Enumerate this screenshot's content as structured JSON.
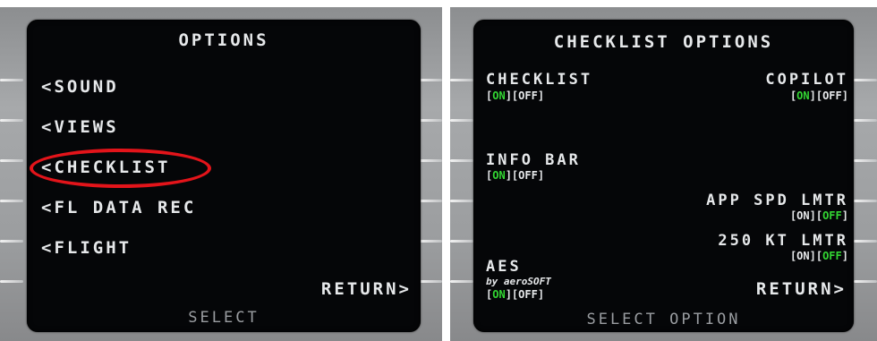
{
  "left_panel": {
    "title": "OPTIONS",
    "items": [
      {
        "label": "<SOUND"
      },
      {
        "label": "<VIEWS"
      },
      {
        "label": "<CHECKLIST"
      },
      {
        "label": "<FL DATA REC"
      },
      {
        "label": "<FLIGHT"
      }
    ],
    "return_label": "RETURN>",
    "footer": "SELECT",
    "highlight_color": "#e3141a"
  },
  "right_panel": {
    "title": "CHECKLIST OPTIONS",
    "checklist": {
      "label": "CHECKLIST",
      "on": "ON",
      "off": "OFF",
      "active": "on"
    },
    "copilot": {
      "label": "COPILOT",
      "on": "ON",
      "off": "OFF",
      "active": "on"
    },
    "info_bar": {
      "label": "INFO BAR",
      "on": "ON",
      "off": "OFF",
      "active": "on"
    },
    "app_spd_lmtr": {
      "label": "APP SPD LMTR",
      "on": "ON",
      "off": "OFF",
      "active": "off"
    },
    "kt_lmtr": {
      "label": "250 KT LMTR",
      "on": "ON",
      "off": "OFF",
      "active": "off"
    },
    "aes": {
      "label": "AES",
      "sublabel": "by aeroSOFT",
      "on": "ON",
      "off": "OFF",
      "active": "on"
    },
    "return_label": "RETURN>",
    "footer": "SELECT OPTION"
  },
  "colors": {
    "screen_bg": "#050608",
    "text": "#e6e8ea",
    "active_green": "#33d633",
    "footer": "#9a9da1",
    "bezel": "#9b9d9f"
  }
}
